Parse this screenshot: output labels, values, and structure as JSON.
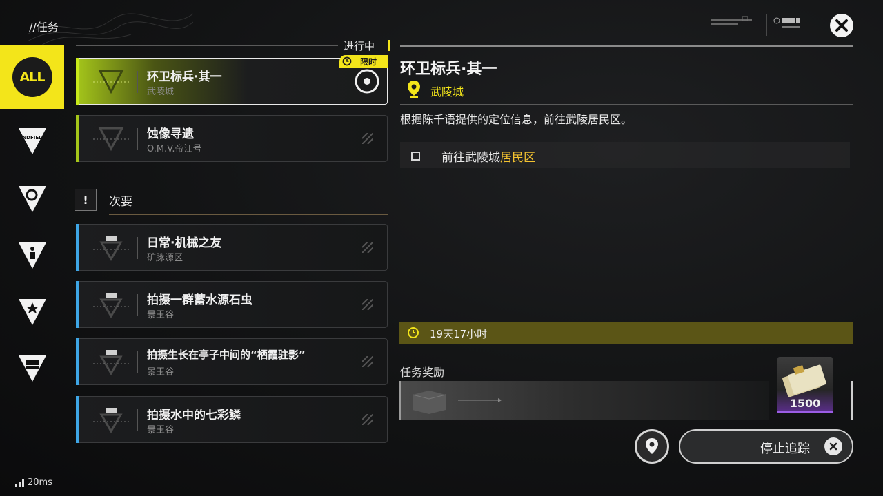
{
  "header": {
    "breadcrumb": "//任务"
  },
  "sidebar": {
    "items": [
      {
        "name": "all",
        "label": "ALL",
        "active": true
      },
      {
        "name": "endfield",
        "label": "ENDFIELD",
        "active": false
      },
      {
        "name": "category-2",
        "label": "",
        "active": false
      },
      {
        "name": "category-3",
        "label": "",
        "active": false
      },
      {
        "name": "category-4",
        "label": "",
        "active": false
      },
      {
        "name": "category-5",
        "label": "",
        "active": false
      }
    ]
  },
  "task_list": {
    "in_progress_label": "进行中",
    "limited_label": "限时",
    "main_tasks": [
      {
        "title": "环卫标兵·其一",
        "location": "武陵城",
        "selected": true
      },
      {
        "title": "蚀像寻遗",
        "location": "O.M.V.帝江号",
        "selected": false
      }
    ],
    "minor_section_label": "次要",
    "minor_tasks": [
      {
        "title": "日常·机械之友",
        "location": "矿脉源区"
      },
      {
        "title": "拍摄一群蓄水源石虫",
        "location": "景玉谷"
      },
      {
        "title": "拍摄生长在亭子中间的“栖霞驻影”",
        "location": "景玉谷"
      },
      {
        "title": "拍摄水中的七彩鳞",
        "location": "景玉谷"
      }
    ]
  },
  "detail": {
    "title": "环卫标兵·其一",
    "location": "武陵城",
    "description": "根据陈千语提供的定位信息，前往武陵居民区。",
    "objective_prefix": "前往武陵城",
    "objective_highlight": "居民区",
    "time_left": "19天17小时",
    "reward_label": "任务奖励",
    "reward_count": "1500",
    "stop_tracking_label": "停止追踪"
  },
  "status": {
    "ping": "20ms"
  },
  "colors": {
    "accent_yellow": "#f3e51a",
    "main_accent_green": "#a5c61a",
    "minor_accent_blue": "#3ea6e6",
    "highlight_orange": "#f3c230"
  }
}
